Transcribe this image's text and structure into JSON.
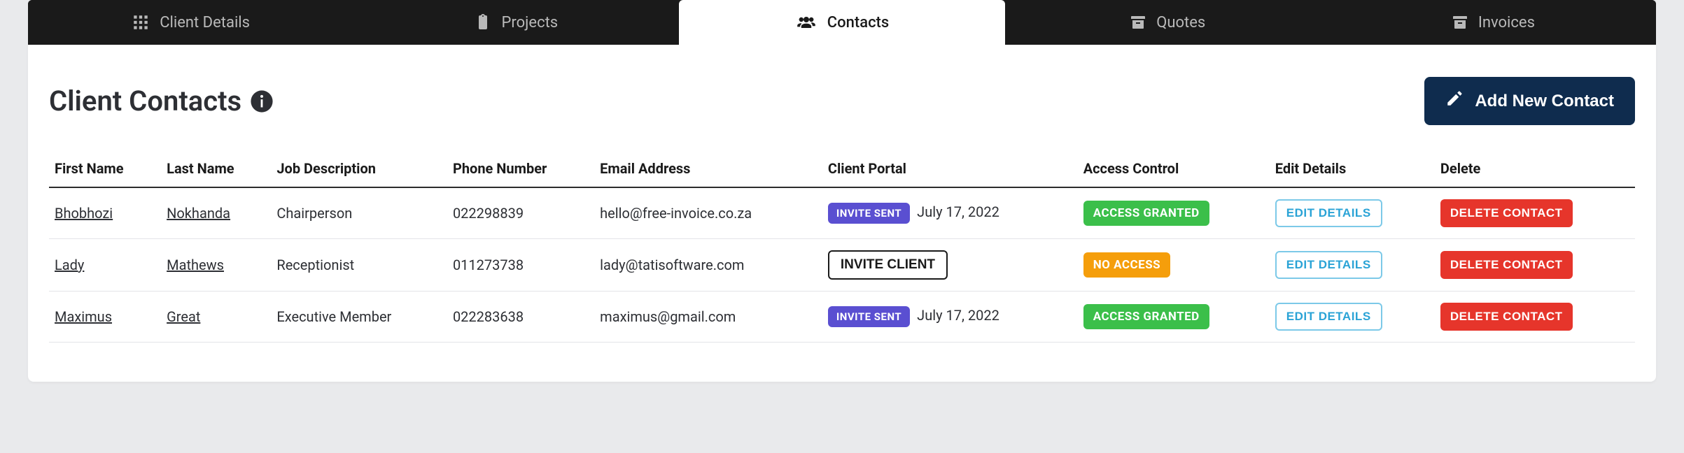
{
  "tabs": [
    {
      "id": "client-details",
      "label": "Client Details",
      "icon": "grid-icon",
      "active": false
    },
    {
      "id": "projects",
      "label": "Projects",
      "icon": "clipboard-icon",
      "active": false
    },
    {
      "id": "contacts",
      "label": "Contacts",
      "icon": "users-icon",
      "active": true
    },
    {
      "id": "quotes",
      "label": "Quotes",
      "icon": "archive-icon",
      "active": false
    },
    {
      "id": "invoices",
      "label": "Invoices",
      "icon": "archive-icon",
      "active": false
    }
  ],
  "page": {
    "title": "Client Contacts",
    "add_button": "Add New Contact"
  },
  "table": {
    "headers": {
      "first_name": "First Name",
      "last_name": "Last Name",
      "job_description": "Job Description",
      "phone_number": "Phone Number",
      "email_address": "Email Address",
      "client_portal": "Client Portal",
      "access_control": "Access Control",
      "edit_details": "Edit Details",
      "delete": "Delete"
    },
    "labels": {
      "invite_sent": "INVITE SENT",
      "invite_client": "INVITE CLIENT",
      "access_granted": "ACCESS GRANTED",
      "no_access": "NO ACCESS",
      "edit_details": "EDIT DETAILS",
      "delete_contact": "DELETE CONTACT"
    },
    "rows": [
      {
        "first_name": "Bhobhozi",
        "last_name": "Nokhanda",
        "job": "Chairperson",
        "phone": "022298839",
        "email": "hello@free-invoice.co.za",
        "portal_state": "invite_sent",
        "portal_date": "July 17, 2022",
        "access": "granted"
      },
      {
        "first_name": "Lady",
        "last_name": "Mathews",
        "job": "Receptionist",
        "phone": "011273738",
        "email": "lady@tatisoftware.com",
        "portal_state": "invite_client",
        "portal_date": "",
        "access": "no_access"
      },
      {
        "first_name": "Maximus",
        "last_name": "Great",
        "job": "Executive Member",
        "phone": "022283638",
        "email": "maximus@gmail.com",
        "portal_state": "invite_sent",
        "portal_date": "July 17, 2022",
        "access": "granted"
      }
    ]
  }
}
